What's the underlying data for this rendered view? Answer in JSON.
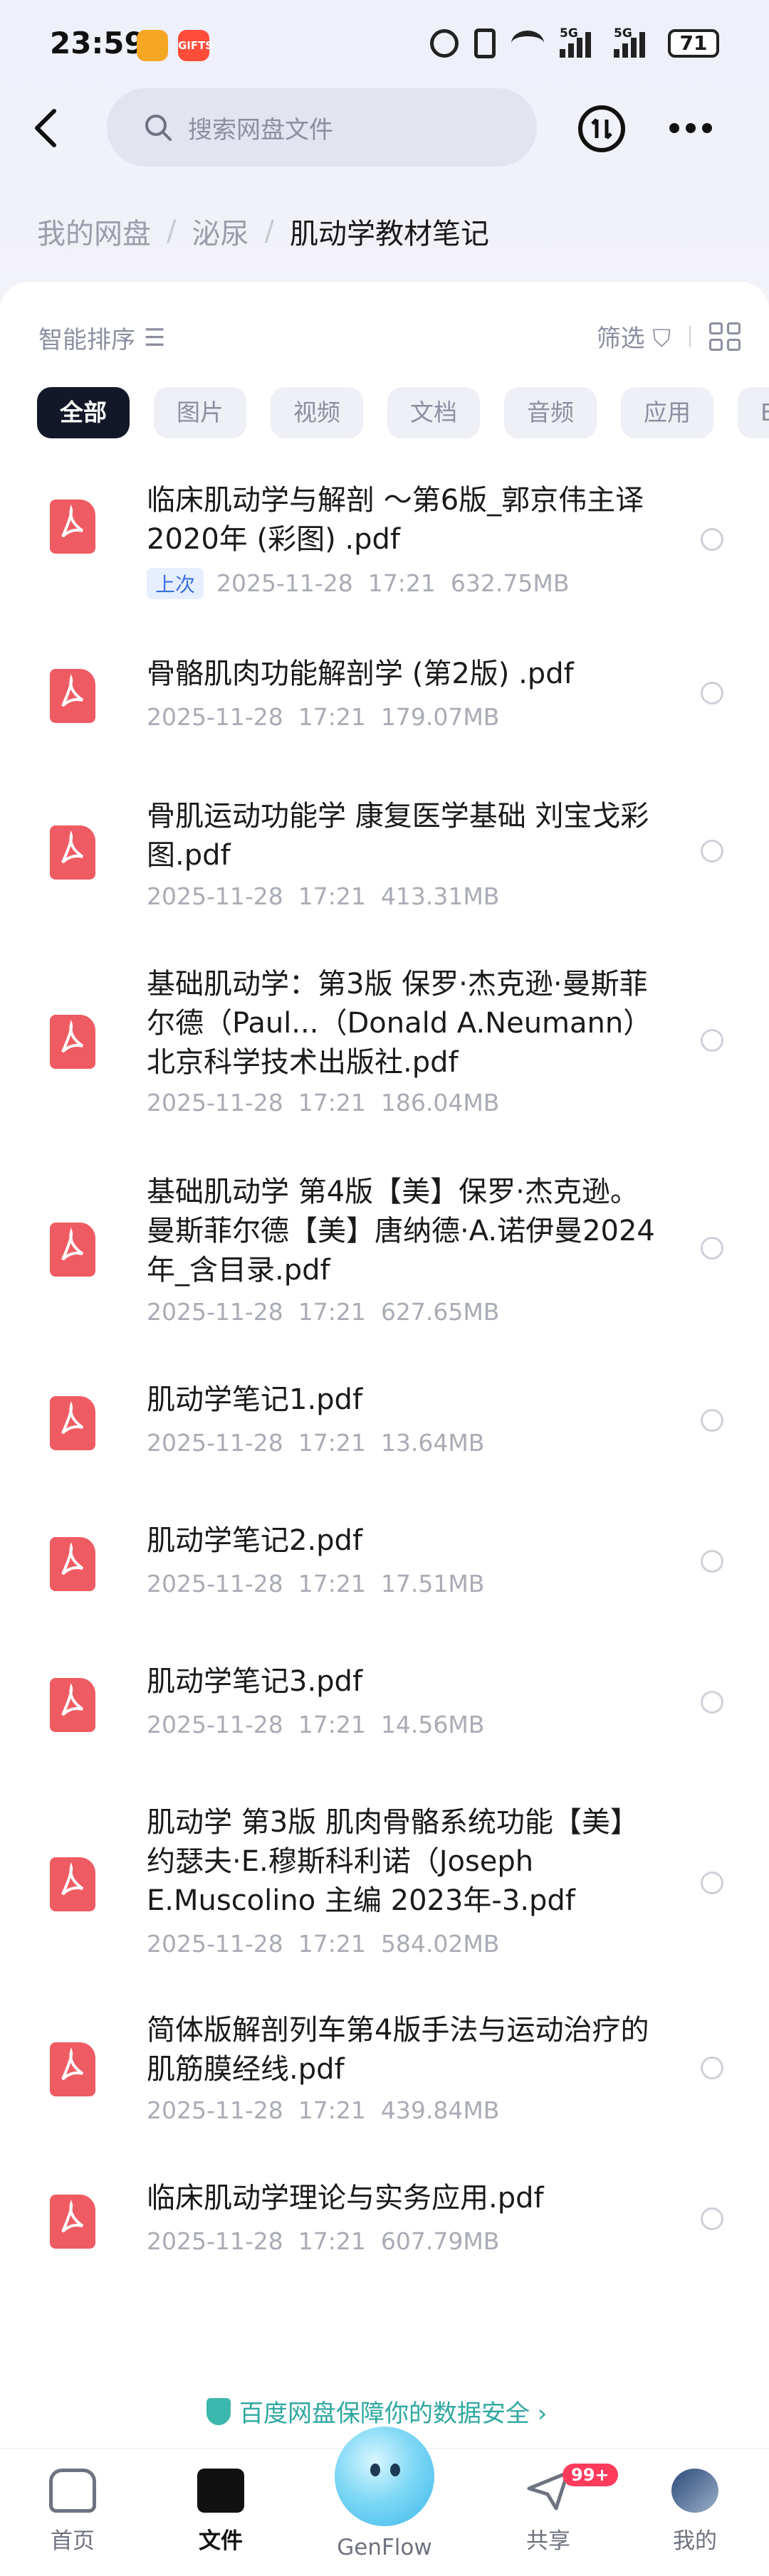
{
  "status_bar": {
    "time": "23:59",
    "app2_label": "GIFTS",
    "net1": "5G",
    "net2": "5G",
    "battery": "71"
  },
  "header": {
    "search_placeholder": "搜索网盘文件"
  },
  "breadcrumb": {
    "items": [
      "我的网盘",
      "泌尿",
      "肌动学教材笔记"
    ]
  },
  "toolbar": {
    "sort_label": "智能排序",
    "filter_label": "筛选"
  },
  "chips": [
    "全部",
    "图片",
    "视频",
    "文档",
    "音频",
    "应用",
    "BT"
  ],
  "files": [
    {
      "name": "临床肌动学与解剖 ～第6版_郭京伟主译2020年 (彩图) .pdf",
      "tag": "上次",
      "date": "2025-11-28",
      "time": "17:21",
      "size": "632.75MB"
    },
    {
      "name": "骨骼肌肉功能解剖学 (第2版) .pdf",
      "tag": "",
      "date": "2025-11-28",
      "time": "17:21",
      "size": "179.07MB"
    },
    {
      "name": "骨肌运动功能学 康复医学基础 刘宝戈彩图.pdf",
      "tag": "",
      "date": "2025-11-28",
      "time": "17:21",
      "size": "413.31MB"
    },
    {
      "name": "基础肌动学：第3版 保罗·杰克逊·曼斯菲尔德（Paul...（Donald A.Neumann）北京科学技术出版社.pdf",
      "tag": "",
      "date": "2025-11-28",
      "time": "17:21",
      "size": "186.04MB"
    },
    {
      "name": "基础肌动学 第4版【美】保罗·杰克逊。曼斯菲尔德【美】唐纳德·A.诺伊曼2024年_含目录.pdf",
      "tag": "",
      "date": "2025-11-28",
      "time": "17:21",
      "size": "627.65MB"
    },
    {
      "name": "肌动学笔记1.pdf",
      "tag": "",
      "date": "2025-11-28",
      "time": "17:21",
      "size": "13.64MB"
    },
    {
      "name": "肌动学笔记2.pdf",
      "tag": "",
      "date": "2025-11-28",
      "time": "17:21",
      "size": "17.51MB"
    },
    {
      "name": "肌动学笔记3.pdf",
      "tag": "",
      "date": "2025-11-28",
      "time": "17:21",
      "size": "14.56MB"
    },
    {
      "name": "肌动学 第3版 肌肉骨骼系统功能【美】约瑟夫·E.穆斯科利诺（Joseph E.Muscolino 主编 2023年-3.pdf",
      "tag": "",
      "date": "2025-11-28",
      "time": "17:21",
      "size": "584.02MB"
    },
    {
      "name": "简体版解剖列车第4版手法与运动治疗的肌筋膜经线.pdf",
      "tag": "",
      "date": "2025-11-28",
      "time": "17:21",
      "size": "439.84MB"
    },
    {
      "name": "临床肌动学理论与实务应用.pdf",
      "tag": "",
      "date": "2025-11-28",
      "time": "17:21",
      "size": "607.79MB"
    }
  ],
  "footer": {
    "security_text": "百度网盘保障你的数据安全 ›"
  },
  "bottom_nav": {
    "home": "首页",
    "files": "文件",
    "genflow": "GenFlow",
    "share": "共享",
    "share_badge": "99+",
    "mine": "我的"
  }
}
